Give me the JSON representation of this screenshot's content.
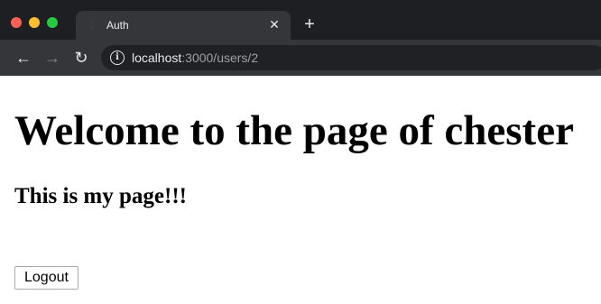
{
  "browser": {
    "tab": {
      "title": "Auth",
      "favicon_glyph": "1"
    },
    "new_tab_label": "+",
    "close_tab_label": "✕",
    "address": {
      "host": "localhost",
      "rest": ":3000/users/2"
    },
    "nav": {
      "back": "←",
      "forward": "→",
      "reload": "↻"
    },
    "info_glyph": "i",
    "colors": {
      "chrome": "#202124",
      "toolbar": "#35363a",
      "close": "#ff5f57",
      "minimize": "#febc2e",
      "maximize": "#28c840"
    }
  },
  "page": {
    "heading": "Welcome to the page of chester",
    "subheading": "This is my page!!!",
    "logout_label": "Logout"
  }
}
